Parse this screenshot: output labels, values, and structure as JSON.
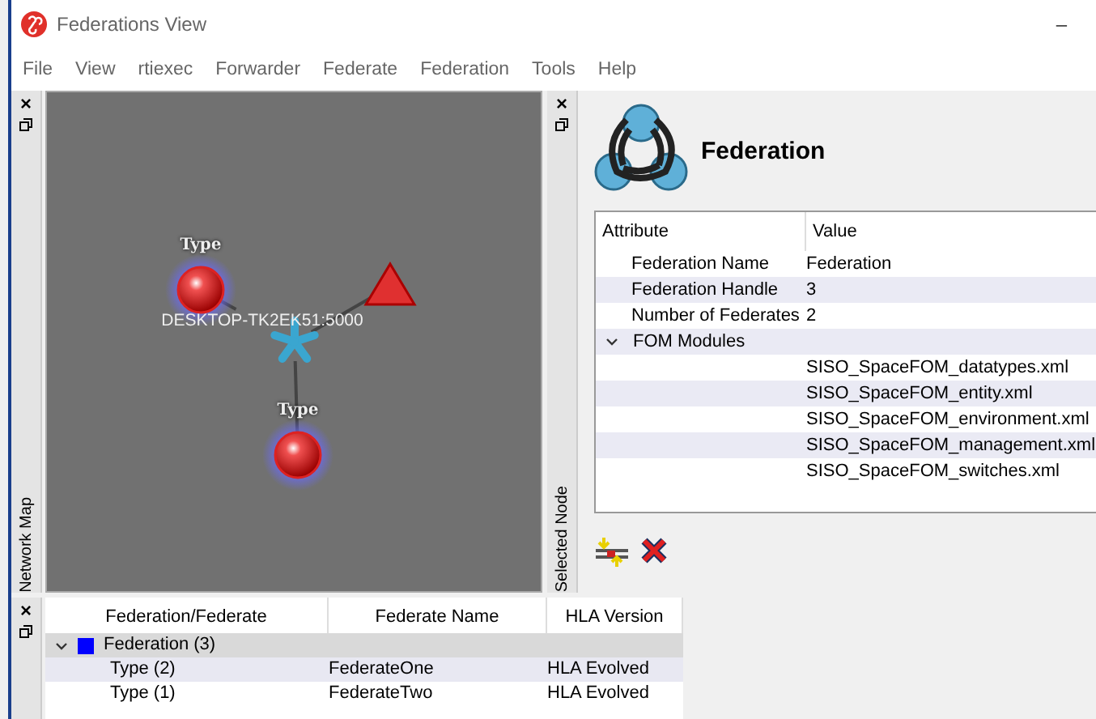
{
  "window": {
    "title": "Federations View",
    "minimize": "–"
  },
  "dock_buttons": {
    "close": "×"
  },
  "menu": [
    "File",
    "View",
    "rtiexec",
    "Forwarder",
    "Federate",
    "Federation",
    "Tools",
    "Help"
  ],
  "network_map": {
    "dock_label": "Network Map",
    "host_label": "DESKTOP-TK2EK51:5000",
    "nodes": [
      {
        "kind": "federate",
        "label": "Type"
      },
      {
        "kind": "rti"
      },
      {
        "kind": "federate",
        "label": "Type"
      },
      {
        "kind": "hub"
      }
    ]
  },
  "selected_node": {
    "dock_label": "Selected Node",
    "title": "Federation",
    "columns": [
      "Attribute",
      "Value"
    ],
    "rows": [
      {
        "attribute": "Federation Name",
        "value": "Federation"
      },
      {
        "attribute": "Federation Handle",
        "value": "3"
      },
      {
        "attribute": "Number of Federates",
        "value": "2"
      },
      {
        "attribute": "FOM Modules",
        "expanded": true,
        "children": [
          {
            "value": "SISO_SpaceFOM_datatypes.xml"
          },
          {
            "value": "SISO_SpaceFOM_entity.xml"
          },
          {
            "value": "SISO_SpaceFOM_environment.xml"
          },
          {
            "value": "SISO_SpaceFOM_management.xml"
          },
          {
            "value": "SISO_SpaceFOM_switches.xml"
          }
        ]
      }
    ]
  },
  "federations": {
    "columns": [
      "Federation/Federate",
      "Federate Name",
      "HLA Version"
    ],
    "rows": [
      {
        "name": "Federation (3)",
        "color": "#0000ff",
        "expanded": true,
        "selected": true,
        "children": [
          {
            "name": "Type (2)",
            "federate_name": "FederateOne",
            "hla_version": "HLA Evolved"
          },
          {
            "name": "Type (1)",
            "federate_name": "FederateTwo",
            "hla_version": "HLA Evolved"
          }
        ]
      }
    ]
  }
}
